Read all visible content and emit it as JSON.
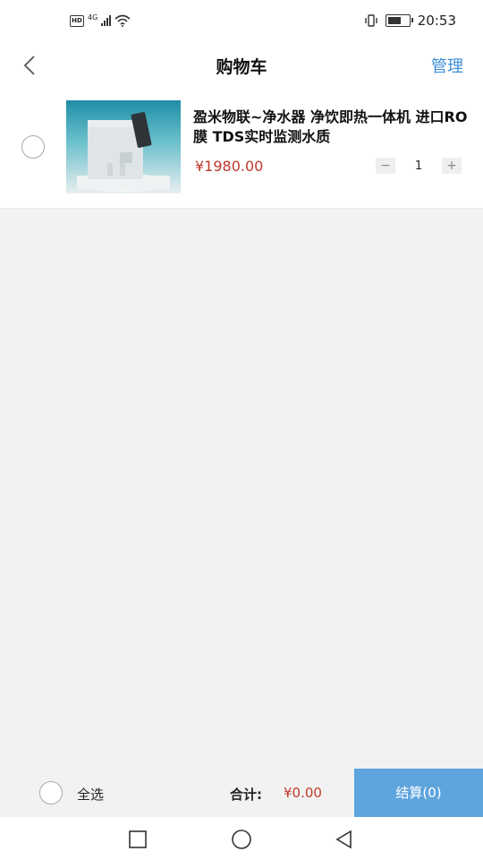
{
  "status_bar": {
    "sim_label": "HD",
    "network_label": "4G",
    "time": "20:53",
    "battery_level": 0.7
  },
  "header": {
    "title": "购物车",
    "manage_label": "管理"
  },
  "cart": {
    "items": [
      {
        "title": "盈米物联~净水器  净饮即热一体机  进口RO膜 TDS实时监测水质",
        "price": "¥1980.00",
        "quantity": "1",
        "selected": false
      }
    ]
  },
  "footer": {
    "select_all_label": "全选",
    "total_label": "合计:",
    "total_value": "¥0.00",
    "checkout_label": "结算(0)"
  },
  "colors": {
    "accent": "#3b8ed8",
    "checkout_bg": "#5ea4dd",
    "price": "#c0392b",
    "background": "#f2f2f2"
  }
}
